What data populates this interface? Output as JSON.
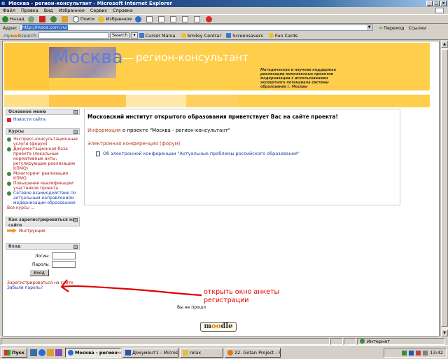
{
  "window": {
    "title": "Москва - регион-консультант - Microsoft Internet Explorer",
    "buttons": [
      "_",
      "□",
      "x"
    ]
  },
  "menu": [
    "Файл",
    "Правка",
    "Вид",
    "Избранное",
    "Сервис",
    "Справка"
  ],
  "toolbar": {
    "back": "Назад",
    "search": "Поиск",
    "favorites": "Избранное"
  },
  "address": {
    "label": "Адрес",
    "url": "http://moos.com.ru/",
    "go": "Переход",
    "links": "Ссылки"
  },
  "links_bar": {
    "brand_prefix": "my",
    "brand_main": "web",
    "brand_suffix": "search",
    "search_btn": "Search",
    "items": [
      "Cursor Mania",
      "Smiley Central",
      "Screensavers",
      "Fun Cards"
    ]
  },
  "banner": {
    "title": "Москва",
    "subtitle": "регион-консультант",
    "description": "Методическая и научная поддержка реализации комплексных проектов модернизации с использованием экспертного потенциала системы образования г. Москвы"
  },
  "main_menu": {
    "header": "Основное меню",
    "items": [
      "Новости сайта"
    ]
  },
  "courses": {
    "header": "Курсы",
    "items": [
      "Экспресс-консультационные услуги (форум)",
      "Документационная база проекта (локальные нормативные акты, регулирующие реализацию КПМО)",
      "Мониторинг реализации КПМО",
      "Повышение квалификации участников проекта",
      "Сетевое взаимодействие по актуальным направлениям модернизации образования"
    ],
    "all": "Все курсы ..."
  },
  "register_block": {
    "header": "Как зарегистрироваться на сайте",
    "item": "Инструкция"
  },
  "login": {
    "header": "Вход",
    "login_label": "Логин:",
    "password_label": "Пароль:",
    "button": "Вход",
    "register_link": "Зарегистрироваться на сайте",
    "forgot_link": "Забыли пароль?"
  },
  "main": {
    "welcome": "Московский институт открытого образования приветствует Вас на сайте проекта!",
    "info_link": "Информация",
    "info_rest": "о проекте \"Москва - регион-консультант\"",
    "conference": "Электронная конференция (форум)",
    "conf_item": "Об электронной конференции \"Актуальные проблемы российского образования\""
  },
  "annotation": {
    "line1": "открыть окно анкеты",
    "line2": "регистрации"
  },
  "footer": {
    "text": "Вы не прошл",
    "logo_m": "m",
    "logo_oo": "oo",
    "logo_rest": "dle"
  },
  "statusbar": {
    "zone": "Интернет"
  },
  "taskbar": {
    "start": "Пуск",
    "tasks": [
      "Москва - регион-консульт...",
      "Документ1 - Microsoft W...",
      "relax",
      "22. Gotan Project - Santa..."
    ],
    "clock": "13:42"
  },
  "colors": {
    "banner": "#ffce4a",
    "title_blue": "#5b7fe0",
    "annotation": "#e00000",
    "link_red": "#b01818"
  }
}
